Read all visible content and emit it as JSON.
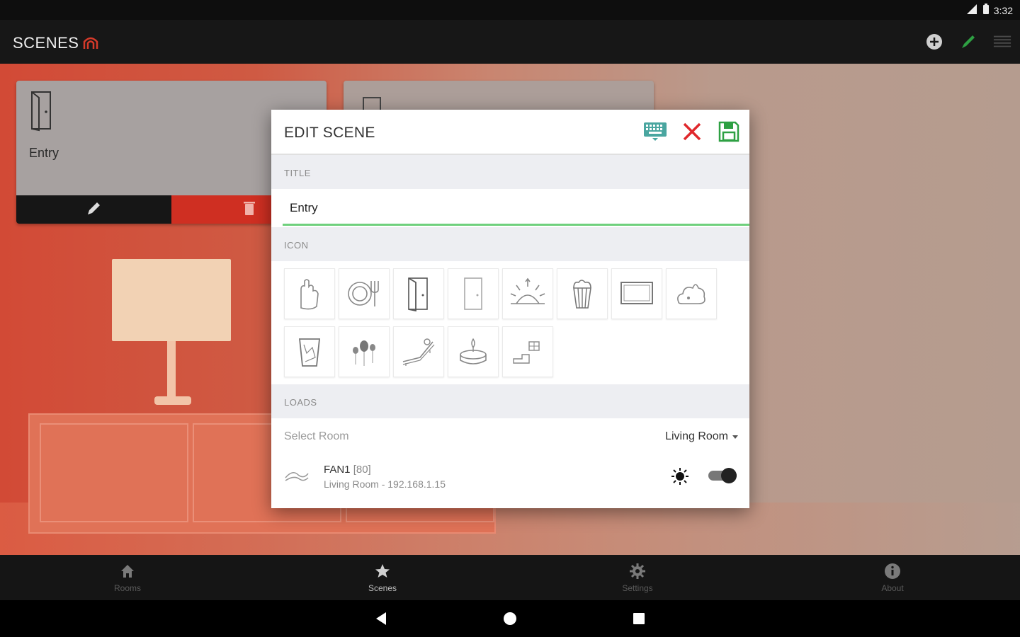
{
  "status_bar": {
    "time": "3:32"
  },
  "app": {
    "title": "SCENES",
    "icons": [
      "add-icon",
      "pencil-icon",
      "menu-icon"
    ],
    "accent": "#d63a2a"
  },
  "cards": [
    {
      "label": "Entry",
      "icon": "door-icon"
    },
    {
      "label": "",
      "icon": "door-icon"
    }
  ],
  "dialog": {
    "title": "EDIT SCENE",
    "actions": [
      "keyboard-icon",
      "close-icon",
      "save-icon"
    ],
    "title_section": "TITLE",
    "title_value": "Entry",
    "icon_section": "ICON",
    "icon_options": [
      "glove-icon",
      "plate-icon",
      "door-open-icon",
      "door-icon",
      "sunrise-icon",
      "popcorn-icon",
      "tv-icon",
      "cloud-icon",
      "trash-bin-icon",
      "balloons-icon",
      "lounger-icon",
      "candle-icon",
      "gift-icon"
    ],
    "loads_section": "LOADS",
    "select_room_label": "Select Room",
    "selected_room": "Living Room",
    "load": {
      "name": "FAN1",
      "code": "[80]",
      "subtitle": "Living Room - 192.168.1.15",
      "enabled": true
    }
  },
  "bottom_nav": [
    {
      "label": "Rooms",
      "icon": "home-icon"
    },
    {
      "label": "Scenes",
      "icon": "star-icon"
    },
    {
      "label": "Settings",
      "icon": "gear-icon"
    },
    {
      "label": "About",
      "icon": "info-icon"
    }
  ],
  "colors": {
    "save": "#2ea043",
    "close": "#e0272b",
    "keyboard": "#4aa6a0",
    "underline": "#6fd07d"
  }
}
